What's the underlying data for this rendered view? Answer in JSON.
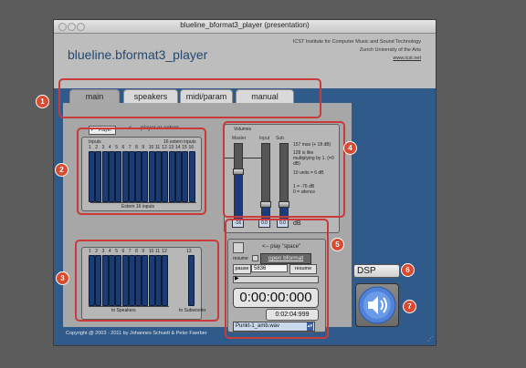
{
  "window": {
    "title": "blueline_bformat3_player (presentation)"
  },
  "header": {
    "app_title": "blueline.bformat3_player",
    "institute_line1": "ICST Institute for Computer Music and Sound Technology",
    "institute_line2": "Zurich University of the Arts",
    "website": "www.icst.net"
  },
  "tabs": [
    {
      "label": "main",
      "active": true
    },
    {
      "label": "speakers",
      "active": false
    },
    {
      "label": "midi/param",
      "active": false
    },
    {
      "label": "manual",
      "active": false
    }
  ],
  "player_toggle": {
    "label": "Player",
    "checked": true,
    "caption": "<---- player or extern"
  },
  "inputs": {
    "label_left": "Inputs",
    "label_right": "16 extern inputs",
    "numbers": [
      "1",
      "2",
      "3",
      "4",
      "5",
      "6",
      "7",
      "8",
      "9",
      "10",
      "11",
      "12",
      "13",
      "14",
      "15",
      "16"
    ],
    "caption": "Extern 16 inputs"
  },
  "volumes": {
    "title": "Volumes",
    "master_label": "Master",
    "input_label": "Input",
    "sub_label": "Sub",
    "master_value": "-16",
    "input_value": "0.0",
    "sub_value": "0.0",
    "master_level": 0.64,
    "input_level": 0.2,
    "sub_level": 0.2,
    "notes": [
      "157 max (+ 18 dB)",
      "128 is like multiplying by 1. (=0 dB)",
      "10 units = 6 dB",
      "1 = -76 dB",
      "0 = silence"
    ],
    "unit": "dB"
  },
  "outputs": {
    "numbers": [
      "1",
      "2",
      "3",
      "4",
      "5",
      "6",
      "7",
      "8",
      "9",
      "10",
      "11",
      "12"
    ],
    "sub_number": "13",
    "to_speakers": "to Speakers",
    "to_subwoofer": "to Subwoofer"
  },
  "player": {
    "play_hint": "<-- play \"space\"",
    "resume_label": "resume",
    "open_label": "open bformat",
    "pause_label": "pause",
    "pause_value": "5836",
    "resume_button": "resume",
    "time_display": "0:00:00:000",
    "duration": "0:02:04:999",
    "file": "Punkt-1_amb.wav"
  },
  "dsp": {
    "label": "DSP"
  },
  "badges": [
    "1",
    "2",
    "3",
    "4",
    "5",
    "6",
    "7"
  ],
  "footer": {
    "copyright": "Copyright @ 2003 - 2011 by Johannes Schuett & Peter Faerber"
  },
  "colors": {
    "window_bg": "#2f5a8a",
    "slot": "#1a3b73",
    "annotation": "#c93a3a"
  }
}
